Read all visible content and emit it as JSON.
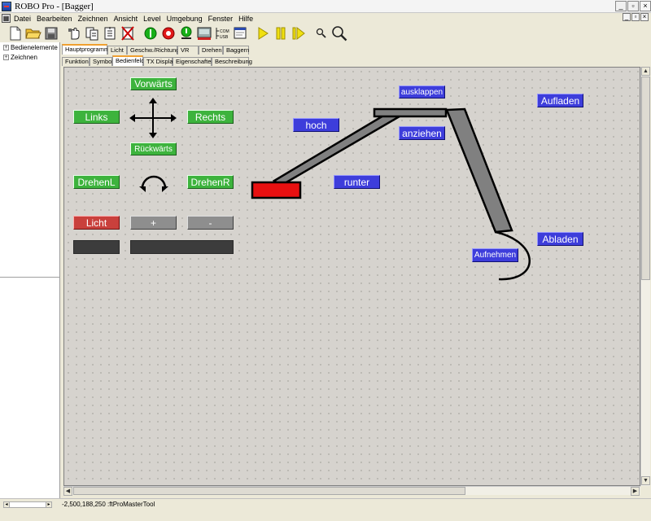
{
  "window": {
    "title": "ROBO Pro - [Bagger]",
    "controls": [
      "_",
      "▫",
      "×"
    ],
    "mdi_controls": [
      "_",
      "▫",
      "×"
    ]
  },
  "menu": [
    "Datei",
    "Bearbeiten",
    "Zeichnen",
    "Ansicht",
    "Level",
    "Umgebung",
    "Fenster",
    "Hilfe"
  ],
  "left_panel": {
    "items": [
      "Bedienelemente",
      "Zeichnen"
    ]
  },
  "tabs_top": [
    {
      "label": "Hauptprogramm",
      "active": true
    },
    {
      "label": "Licht",
      "active": false
    },
    {
      "label": "Geschw./Richtung",
      "active": false
    },
    {
      "label": "VR",
      "active": false
    },
    {
      "label": "Drehen",
      "active": false
    },
    {
      "label": "Baggern",
      "active": false
    }
  ],
  "tabs_sub": [
    {
      "label": "Funktion",
      "active": false
    },
    {
      "label": "Symbol",
      "active": false
    },
    {
      "label": "Bedienfeld",
      "active": true
    },
    {
      "label": "TX Display",
      "active": false
    },
    {
      "label": "Eigenschaften",
      "active": false
    },
    {
      "label": "Beschreibung",
      "active": false
    }
  ],
  "panel": {
    "vorwaerts": "Vorwärts",
    "links": "Links",
    "rechts": "Rechts",
    "rueckwaerts": "Rückwärts",
    "drehenl": "DrehenL",
    "drehenr": "DrehenR",
    "licht": "Licht",
    "plus": "+",
    "minus": "-",
    "ausklappen": "ausklappen",
    "hoch": "hoch",
    "anziehen": "anziehen",
    "runter": "runter",
    "aufladen": "Aufladen",
    "abladen": "Abladen",
    "aufnehmen": "Aufnehmen"
  },
  "colors": {
    "green": "#3db33d",
    "blue": "#3d3ddb",
    "red": "#c9403c",
    "arm_gray": "#808080",
    "bucket_red": "#e81010"
  },
  "status": {
    "text": "-2,500,188,250 :ftProMasterTool"
  }
}
